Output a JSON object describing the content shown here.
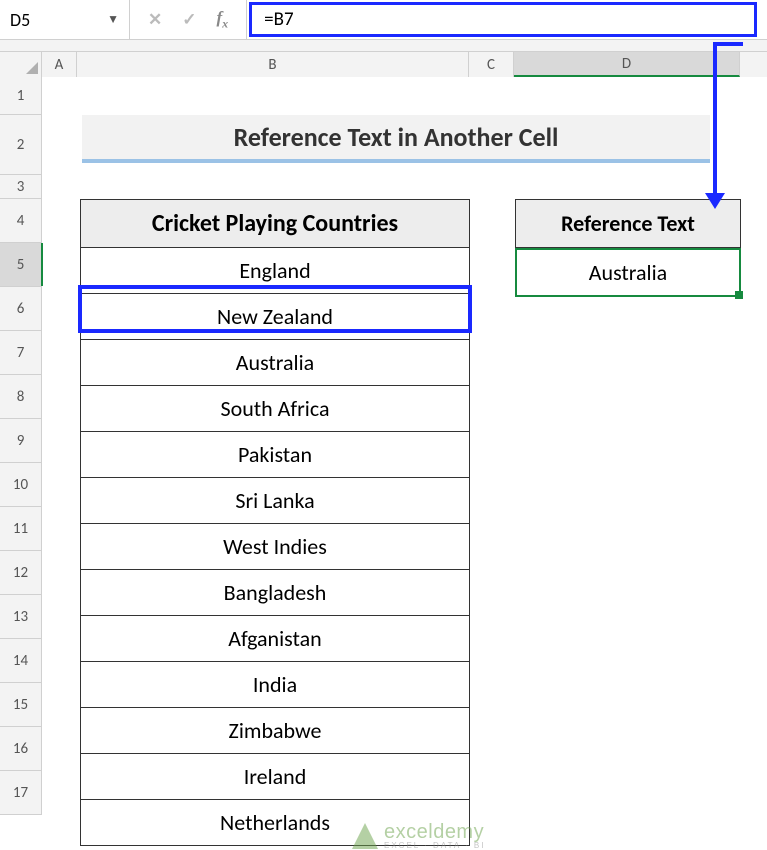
{
  "name_box": {
    "value": "D5"
  },
  "formula_bar": {
    "content": "=B7"
  },
  "columns": {
    "A": "A",
    "B": "B",
    "C": "C",
    "D": "D"
  },
  "rows": [
    "1",
    "2",
    "3",
    "4",
    "5",
    "6",
    "7",
    "8",
    "9",
    "10",
    "11",
    "12",
    "13",
    "14",
    "15",
    "16",
    "17"
  ],
  "title": "Reference Text in Another Cell",
  "countries_header": "Cricket Playing Countries",
  "countries": [
    "England",
    "New Zealand",
    "Australia",
    "South Africa",
    "Pakistan",
    "Sri Lanka",
    "West Indies",
    "Bangladesh",
    "Afganistan",
    "India",
    "Zimbabwe",
    "Ireland",
    "Netherlands"
  ],
  "reference_header": "Reference Text",
  "reference_value": "Australia",
  "selected_cell": "D5",
  "highlighted_source": "B7",
  "watermark": {
    "main": "exceldemy",
    "sub": "EXCEL · DATA · BI"
  }
}
